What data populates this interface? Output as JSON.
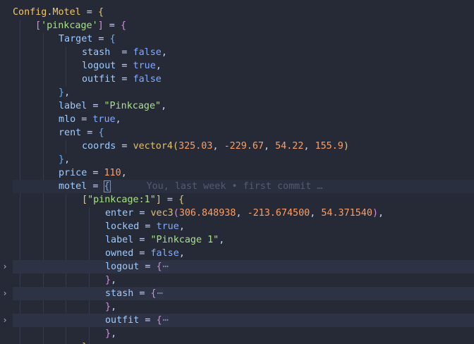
{
  "editor": {
    "fold_glyph": "›",
    "collapsed_ellipsis": "⋯",
    "blame": "You, last week • first commit …"
  },
  "code": {
    "l1": {
      "a": "Config",
      "b": ".",
      "c": "Motel",
      "d": " = ",
      "e": "{"
    },
    "l2": {
      "a": "[",
      "b": "'pinkcage'",
      "c": "]",
      "d": " = ",
      "e": "{"
    },
    "l3": {
      "a": "Target",
      "b": " = ",
      "c": "{"
    },
    "l4": {
      "a": "stash",
      "b": "  = ",
      "c": "false",
      "d": ","
    },
    "l5": {
      "a": "logout",
      "b": " = ",
      "c": "true",
      "d": ","
    },
    "l6": {
      "a": "outfit",
      "b": " = ",
      "c": "false"
    },
    "l7": {
      "a": "}",
      "b": ","
    },
    "l8": {
      "a": "label",
      "b": " = ",
      "c": "\"Pinkcage\"",
      "d": ","
    },
    "l9": {
      "a": "mlo",
      "b": " = ",
      "c": "true",
      "d": ","
    },
    "l10": {
      "a": "rent",
      "b": " = ",
      "c": "{"
    },
    "l11": {
      "a": "coords",
      "b": " = ",
      "c": "vector4",
      "d": "(",
      "e": "325.03",
      "f": ", ",
      "g": "-229.67",
      "h": ", ",
      "i": "54.22",
      "j": ", ",
      "k": "155.9",
      "l": ")"
    },
    "l12": {
      "a": "}",
      "b": ","
    },
    "l13": {
      "a": "price",
      "b": " = ",
      "c": "110",
      "d": ","
    },
    "l14": {
      "a": "motel",
      "b": " = ",
      "c": "{"
    },
    "l15": {
      "a": "[",
      "b": "\"pinkcage:1\"",
      "c": "]",
      "d": " = ",
      "e": "{"
    },
    "l16": {
      "a": "enter",
      "b": " = ",
      "c": "vec3",
      "d": "(",
      "e": "306.848938",
      "f": ", ",
      "g": "-213.674500",
      "h": ", ",
      "i": "54.371540",
      "j": ")",
      "k": ","
    },
    "l17": {
      "a": "locked",
      "b": " = ",
      "c": "true",
      "d": ","
    },
    "l18": {
      "a": "label",
      "b": " = ",
      "c": "\"Pinkcage 1\"",
      "d": ","
    },
    "l19": {
      "a": "owned",
      "b": " = ",
      "c": "false",
      "d": ","
    },
    "l20": {
      "a": "logout",
      "b": " = ",
      "c": "{"
    },
    "l21": {
      "a": "}",
      "b": ","
    },
    "l22": {
      "a": "stash",
      "b": " = ",
      "c": "{"
    },
    "l23": {
      "a": "}",
      "b": ","
    },
    "l24": {
      "a": "outfit",
      "b": " = ",
      "c": "{"
    },
    "l25": {
      "a": "}",
      "b": ","
    },
    "l26": {
      "a": "}",
      "b": ","
    }
  }
}
